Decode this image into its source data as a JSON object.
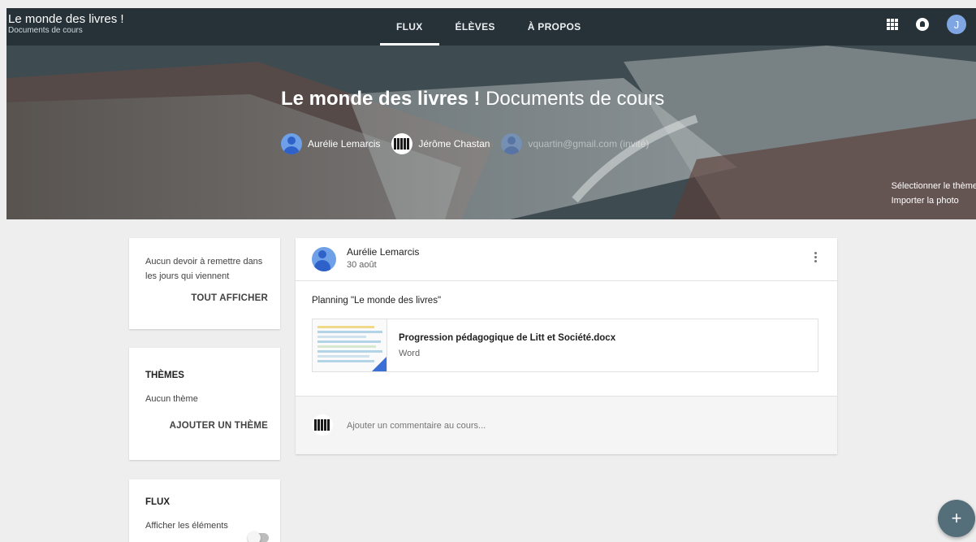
{
  "app": {
    "title": "Le monde des livres !",
    "subtitle": "Documents de cours"
  },
  "tabs": [
    {
      "label": "FLUX",
      "active": true
    },
    {
      "label": "ÉLÈVES",
      "active": false
    },
    {
      "label": "À PROPOS",
      "active": false
    }
  ],
  "account": {
    "initial": "J"
  },
  "hero": {
    "title_bold": "Le monde des livres !",
    "title_light": "Documents de cours",
    "teachers": [
      {
        "name": "Aurélie Lemarcis",
        "avatar": "user-avatar"
      },
      {
        "name": "Jérôme Chastan",
        "avatar": "piano-avatar"
      },
      {
        "name": "vquartin@gmail.com (invité)",
        "avatar": "user-avatar"
      }
    ],
    "theme_select": "Sélectionner le thème",
    "theme_import": "Importer la photo"
  },
  "sidebar": {
    "upcoming": {
      "text": "Aucun devoir à remettre dans les jours qui viennent",
      "action": "TOUT AFFICHER"
    },
    "themes": {
      "heading": "THÈMES",
      "empty": "Aucun thème",
      "action": "AJOUTER UN THÈME"
    },
    "stream": {
      "heading": "FLUX",
      "toggle_label": "Afficher les éléments"
    }
  },
  "post": {
    "author": "Aurélie Lemarcis",
    "date": "30 août",
    "text": "Planning \"Le monde des livres\"",
    "attachment": {
      "name": "Progression pédagogique de Litt et Société.docx",
      "type": "Word"
    },
    "comment_placeholder": "Ajouter un commentaire au cours..."
  },
  "fab": {
    "label": "+"
  },
  "colors": {
    "topbar": "#263238",
    "accent": "#3b6fd6",
    "fab": "#546e7a"
  }
}
